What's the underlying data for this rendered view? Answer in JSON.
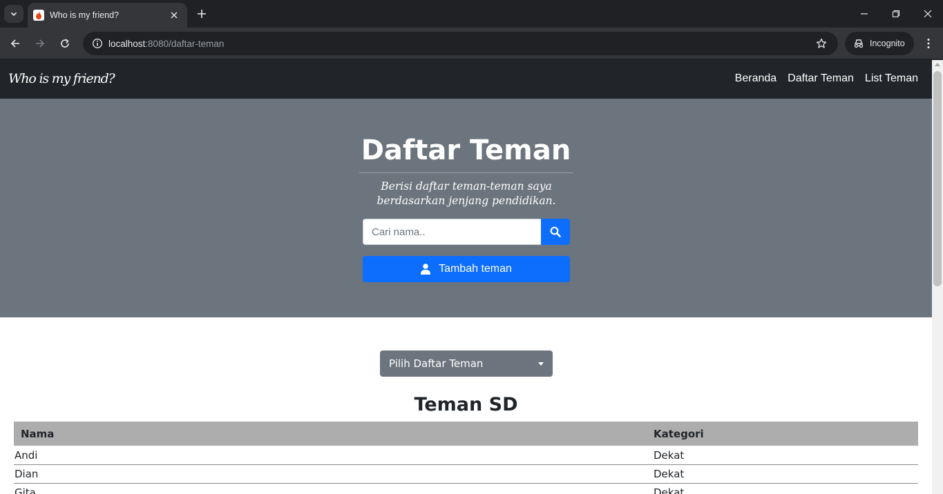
{
  "browser": {
    "tab_title": "Who is my friend?",
    "url_host": "localhost",
    "url_path": ":8080/daftar-teman",
    "profile_label": "Incognito"
  },
  "navbar": {
    "brand": "Who is my friend?",
    "links": [
      "Beranda",
      "Daftar Teman",
      "List Teman"
    ]
  },
  "hero": {
    "title": "Daftar Teman",
    "lead": "Berisi daftar teman-teman saya berdasarkan jenjang pendidikan.",
    "search_placeholder": "Cari nama..",
    "add_button": "Tambah teman"
  },
  "selector": {
    "label": "Pilih Daftar Teman"
  },
  "section": {
    "title": "Teman SD"
  },
  "table": {
    "headers": [
      "Nama",
      "Kategori"
    ],
    "rows": [
      [
        "Andi",
        "Dekat"
      ],
      [
        "Dian",
        "Dekat"
      ],
      [
        "Gita",
        "Dekat"
      ]
    ]
  },
  "colors": {
    "navbar_bg": "#212529",
    "hero_bg": "#6c757d",
    "primary": "#0d6efd",
    "table_header_bg": "#adadad"
  }
}
